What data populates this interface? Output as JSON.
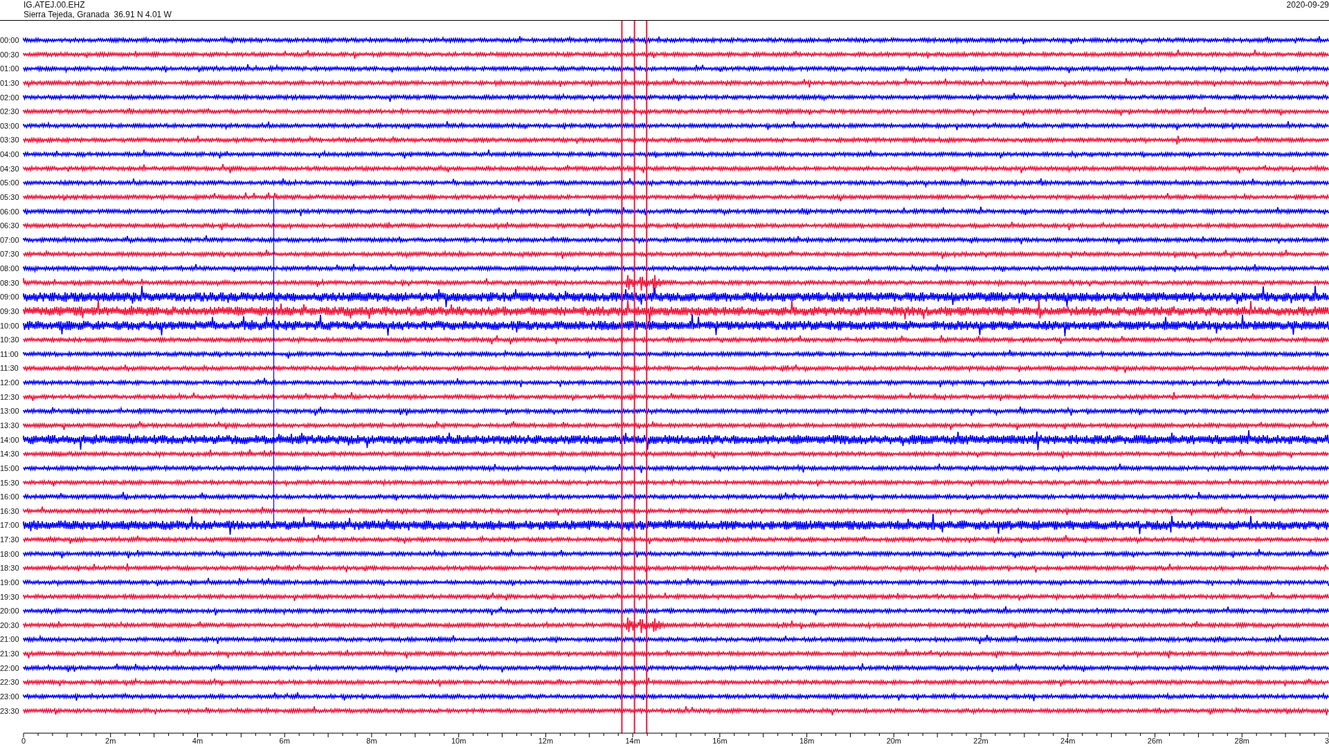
{
  "header": {
    "station": "IG.ATEJ.00.EHZ",
    "location": "Sierra Tejeda, Granada  36.91 N 4.01 W",
    "date": "2020-09-29"
  },
  "rows": [
    {
      "time": "00:00",
      "color": "#0000ff",
      "kind": "quiet"
    },
    {
      "time": "00:30",
      "color": "#f2163c",
      "kind": "quiet"
    },
    {
      "time": "01:00",
      "color": "#0000ff",
      "kind": "quiet"
    },
    {
      "time": "01:30",
      "color": "#f2163c",
      "kind": "quiet"
    },
    {
      "time": "02:00",
      "color": "#0000ff",
      "kind": "quiet"
    },
    {
      "time": "02:30",
      "color": "#f2163c",
      "kind": "quiet"
    },
    {
      "time": "03:00",
      "color": "#0000ff",
      "kind": "quiet"
    },
    {
      "time": "03:30",
      "color": "#f2163c",
      "kind": "quiet"
    },
    {
      "time": "04:00",
      "color": "#0000ff",
      "kind": "quiet"
    },
    {
      "time": "04:30",
      "color": "#f2163c",
      "kind": "quiet"
    },
    {
      "time": "05:00",
      "color": "#0000ff",
      "kind": "quiet"
    },
    {
      "time": "05:30",
      "color": "#f2163c",
      "kind": "quiet"
    },
    {
      "time": "06:00",
      "color": "#0000ff",
      "kind": "quiet"
    },
    {
      "time": "06:30",
      "color": "#f2163c",
      "kind": "quiet"
    },
    {
      "time": "07:00",
      "color": "#0000ff",
      "kind": "quiet"
    },
    {
      "time": "07:30",
      "color": "#f2163c",
      "kind": "quiet"
    },
    {
      "time": "08:00",
      "color": "#0000ff",
      "kind": "quiet"
    },
    {
      "time": "08:30",
      "color": "#f2163c",
      "kind": "event"
    },
    {
      "time": "09:00",
      "color": "#0000ff",
      "kind": "noisy"
    },
    {
      "time": "09:30",
      "color": "#f2163c",
      "kind": "noisy"
    },
    {
      "time": "10:00",
      "color": "#0000ff",
      "kind": "noisy"
    },
    {
      "time": "10:30",
      "color": "#f2163c",
      "kind": "quiet"
    },
    {
      "time": "11:00",
      "color": "#0000ff",
      "kind": "quiet"
    },
    {
      "time": "11:30",
      "color": "#f2163c",
      "kind": "quiet"
    },
    {
      "time": "12:00",
      "color": "#0000ff",
      "kind": "quiet"
    },
    {
      "time": "12:30",
      "color": "#f2163c",
      "kind": "quiet"
    },
    {
      "time": "13:00",
      "color": "#0000ff",
      "kind": "quiet"
    },
    {
      "time": "13:30",
      "color": "#f2163c",
      "kind": "quiet"
    },
    {
      "time": "14:00",
      "color": "#0000ff",
      "kind": "noisy"
    },
    {
      "time": "14:30",
      "color": "#f2163c",
      "kind": "quiet"
    },
    {
      "time": "15:00",
      "color": "#0000ff",
      "kind": "quiet"
    },
    {
      "time": "15:30",
      "color": "#f2163c",
      "kind": "quiet"
    },
    {
      "time": "16:00",
      "color": "#0000ff",
      "kind": "quiet"
    },
    {
      "time": "16:30",
      "color": "#f2163c",
      "kind": "quiet"
    },
    {
      "time": "17:00",
      "color": "#0000ff",
      "kind": "noisy"
    },
    {
      "time": "17:30",
      "color": "#f2163c",
      "kind": "quiet"
    },
    {
      "time": "18:00",
      "color": "#0000ff",
      "kind": "quiet"
    },
    {
      "time": "18:30",
      "color": "#f2163c",
      "kind": "quiet"
    },
    {
      "time": "19:00",
      "color": "#0000ff",
      "kind": "quiet"
    },
    {
      "time": "19:30",
      "color": "#f2163c",
      "kind": "quiet"
    },
    {
      "time": "20:00",
      "color": "#0000ff",
      "kind": "quiet"
    },
    {
      "time": "20:30",
      "color": "#f2163c",
      "kind": "event"
    },
    {
      "time": "21:00",
      "color": "#0000ff",
      "kind": "quiet"
    },
    {
      "time": "21:30",
      "color": "#f2163c",
      "kind": "quiet"
    },
    {
      "time": "22:00",
      "color": "#0000ff",
      "kind": "quiet"
    },
    {
      "time": "22:30",
      "color": "#f2163c",
      "kind": "quiet"
    },
    {
      "time": "23:00",
      "color": "#0000ff",
      "kind": "quiet"
    },
    {
      "time": "23:30",
      "color": "#f2163c",
      "kind": "quiet"
    }
  ],
  "axis": {
    "labels": [
      "0",
      "2m",
      "4m",
      "6m",
      "8m",
      "10m",
      "12m",
      "14m",
      "16m",
      "18m",
      "20m",
      "22m",
      "24m",
      "26m",
      "28m",
      "3"
    ]
  }
}
